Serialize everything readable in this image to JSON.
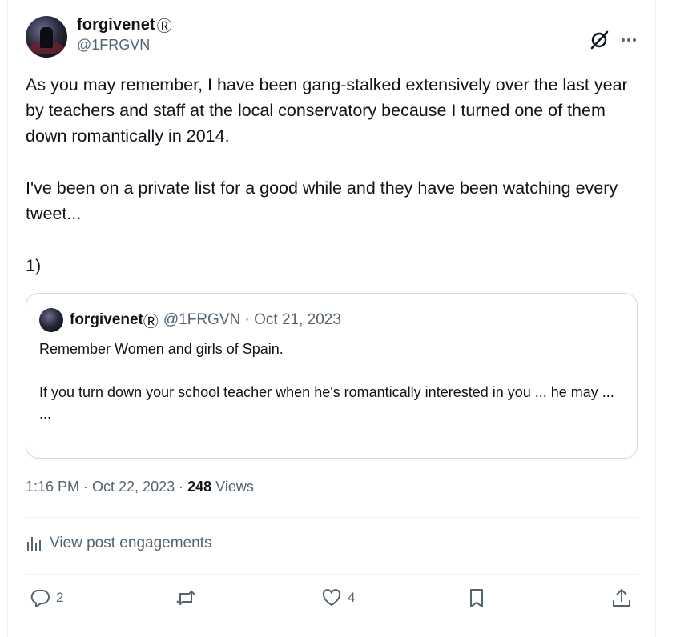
{
  "author": {
    "display_name": "forgivenet",
    "verified_mark": "Ⓡ",
    "handle": "@1FRGVN"
  },
  "icons": {
    "grok": "grok-icon",
    "more": "more-icon",
    "analytics": "analytics-icon",
    "reply": "reply-icon",
    "repost": "repost-icon",
    "like": "like-icon",
    "bookmark": "bookmark-icon",
    "share": "share-icon"
  },
  "tweet": {
    "paragraphs": [
      "As you may remember, I have been gang-stalked extensively over the last year by teachers and staff at the local conservatory because I turned one of them down romantically in 2014.",
      "I've been on a private list for a good while and they have been watching every tweet...",
      "1)"
    ]
  },
  "quote": {
    "display_name": "forgivenet",
    "verified_mark": "Ⓡ",
    "meta": "@1FRGVN · Oct 21, 2023",
    "lines": [
      "Remember Women and girls of Spain.",
      "If you turn down your school teacher when he's romantically interested in you ... he may ...",
      "..."
    ]
  },
  "meta": {
    "time": "1:16 PM · Oct 22, 2023 · ",
    "views_count": "248",
    "views_label": " Views"
  },
  "engagements_label": "View post engagements",
  "actions": {
    "replies": "2",
    "likes": "4"
  },
  "colors": {
    "text": "#0f1419",
    "secondary": "#536471",
    "border": "#cfd9de",
    "divider": "#eff3f4"
  }
}
